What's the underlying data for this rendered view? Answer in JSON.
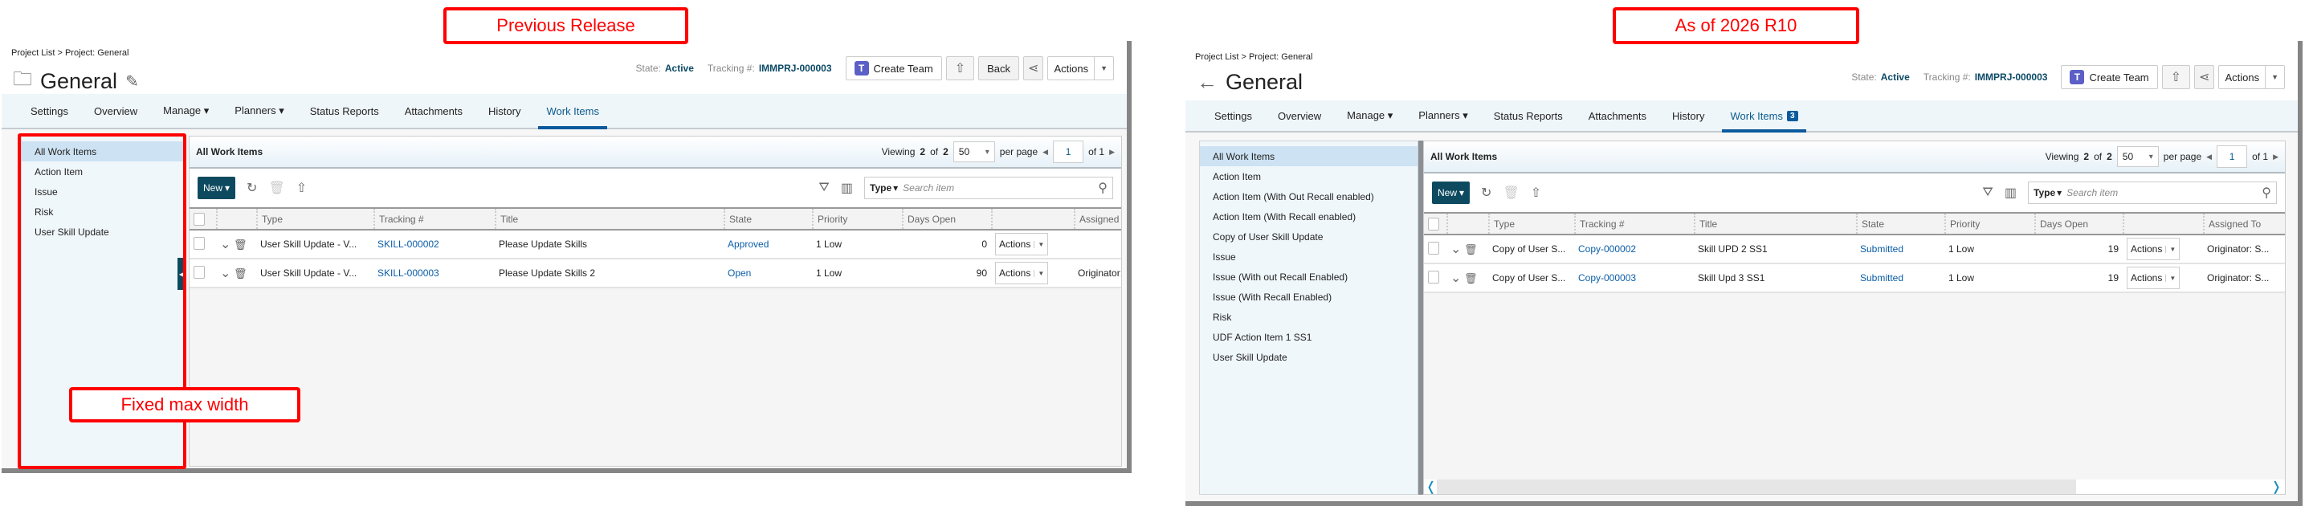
{
  "annotations": {
    "previous": "Previous Release",
    "current": "As of 2026 R10",
    "fixed": "Fixed max width"
  },
  "colors": {
    "annotation": "#ff0000",
    "accent": "#0b5a9e",
    "new_button": "#0e4a5f",
    "link": "#0b5ea8",
    "sidebar_bg": "#f0f7fb",
    "sidebar_selected": "#cde2f3"
  },
  "previous": {
    "breadcrumb": "Project List > Project: General",
    "title": "General",
    "title_icon": "folder-icon",
    "state_label": "State:",
    "state_value": "Active",
    "tracking_label": "Tracking #:",
    "tracking_value": "IMMPRJ-000003",
    "create_team": "Create Team",
    "back": "Back",
    "actions": "Actions",
    "tabs": [
      {
        "label": "Settings"
      },
      {
        "label": "Overview"
      },
      {
        "label": "Manage ▾"
      },
      {
        "label": "Planners ▾"
      },
      {
        "label": "Status Reports"
      },
      {
        "label": "Attachments"
      },
      {
        "label": "History"
      },
      {
        "label": "Work Items",
        "active": true
      }
    ],
    "sidebar": [
      "All Work Items",
      "Action Item",
      "Issue",
      "Risk",
      "User Skill Update"
    ],
    "grid": {
      "title": "All Work Items",
      "viewing": "Viewing",
      "count": "2",
      "of": "of",
      "total": "2",
      "page_size": "50",
      "per_page": "per page",
      "page": "1",
      "of_pages": "of 1",
      "new_label": "New",
      "type_filter": "Type",
      "search_placeholder": "Search item",
      "columns": [
        "Type",
        "Tracking #",
        "Title",
        "State",
        "Priority",
        "Days Open",
        "",
        "Assigned To"
      ],
      "row_actions": "Actions",
      "rows": [
        {
          "type": "User Skill Update - V...",
          "tracking": "SKILL-000002",
          "title": "Please Update Skills",
          "state": "Approved",
          "priority": "1 Low",
          "days_open": "0",
          "assigned": ""
        },
        {
          "type": "User Skill Update - V...",
          "tracking": "SKILL-000003",
          "title": "Please Update Skills 2",
          "state": "Open",
          "priority": "1 Low",
          "days_open": "90",
          "assigned": "Originator: S..."
        }
      ]
    }
  },
  "current": {
    "breadcrumb": "Project List > Project: General",
    "title": "General",
    "title_icon": "back-arrow-icon",
    "state_label": "State:",
    "state_value": "Active",
    "tracking_label": "Tracking #:",
    "tracking_value": "IMMPRJ-000003",
    "create_team": "Create Team",
    "actions": "Actions",
    "tabs": [
      {
        "label": "Settings"
      },
      {
        "label": "Overview"
      },
      {
        "label": "Manage ▾"
      },
      {
        "label": "Planners ▾"
      },
      {
        "label": "Status Reports"
      },
      {
        "label": "Attachments"
      },
      {
        "label": "History"
      },
      {
        "label": "Work Items",
        "active": true,
        "badge": "3"
      }
    ],
    "sidebar": [
      "All Work Items",
      "Action Item",
      "Action Item (With Out Recall enabled)",
      "Action Item (With Recall enabled)",
      "Copy of User Skill Update",
      "Issue",
      "Issue (With out Recall Enabled)",
      "Issue (With Recall Enabled)",
      "Risk",
      "UDF Action Item 1 SS1",
      "User Skill Update"
    ],
    "grid": {
      "title": "All Work Items",
      "viewing": "Viewing",
      "count": "2",
      "of": "of",
      "total": "2",
      "page_size": "50",
      "per_page": "per page",
      "page": "1",
      "of_pages": "of 1",
      "new_label": "New",
      "type_filter": "Type",
      "search_placeholder": "Search item",
      "columns": [
        "Type",
        "Tracking #",
        "Title",
        "State",
        "Priority",
        "Days Open",
        "",
        "Assigned To"
      ],
      "row_actions": "Actions",
      "rows": [
        {
          "type": "Copy of User S...",
          "tracking": "Copy-000002",
          "title": "Skill UPD 2 SS1",
          "state": "Submitted",
          "priority": "1 Low",
          "days_open": "19",
          "assigned": "Originator: S..."
        },
        {
          "type": "Copy of User S...",
          "tracking": "Copy-000003",
          "title": "Skill Upd 3 SS1",
          "state": "Submitted",
          "priority": "1 Low",
          "days_open": "19",
          "assigned": "Originator: S..."
        }
      ]
    }
  }
}
